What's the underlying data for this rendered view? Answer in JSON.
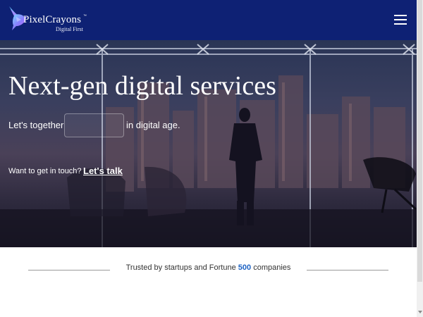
{
  "header": {
    "brand": "PixelCrayons",
    "trademark": "™",
    "tagline": "Digital First",
    "logo_icon": "hummingbird-icon",
    "menu_icon": "hamburger-menu-icon",
    "background": "#0e2174"
  },
  "hero": {
    "title": "Next-gen digital services",
    "together_prefix": "Let's together",
    "together_suffix": "in digital age.",
    "rotating_word": "",
    "touch_prompt": "Want to get in touch?",
    "cta_link": "Let's talk"
  },
  "trusted": {
    "prefix": "Trusted by startups and Fortune ",
    "count": "500",
    "suffix": " companies",
    "accent": "#1f64c4"
  }
}
